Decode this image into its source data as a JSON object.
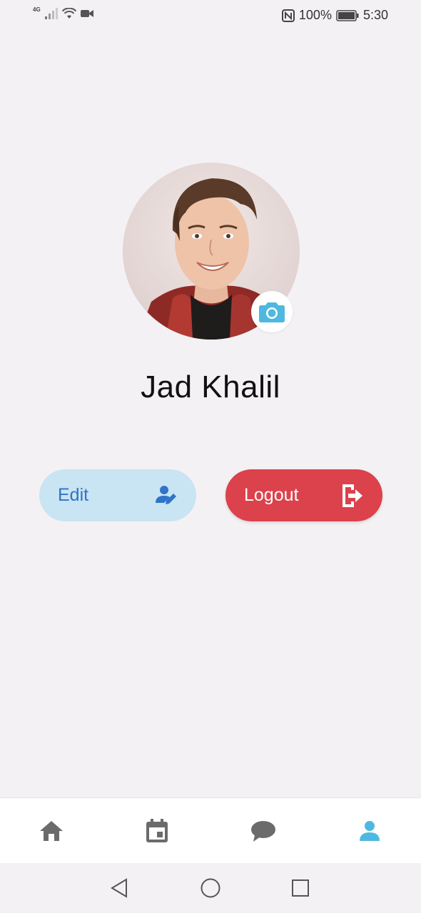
{
  "status_bar": {
    "network": "4G",
    "battery": "100%",
    "time": "5:30"
  },
  "profile": {
    "name": "Jad Khalil"
  },
  "actions": {
    "edit_label": "Edit",
    "logout_label": "Logout"
  },
  "colors": {
    "accent": "#4fb8e0",
    "edit_bg": "#c9e4f2",
    "edit_text": "#2f74c8",
    "logout_bg": "#db424b",
    "nav_inactive": "#6b6b6b"
  },
  "bottom_nav": {
    "items": [
      {
        "name": "home",
        "icon": "home-icon",
        "active": false
      },
      {
        "name": "calendar",
        "icon": "calendar-icon",
        "active": false
      },
      {
        "name": "messages",
        "icon": "chat-icon",
        "active": false
      },
      {
        "name": "profile",
        "icon": "person-icon",
        "active": true
      }
    ]
  }
}
